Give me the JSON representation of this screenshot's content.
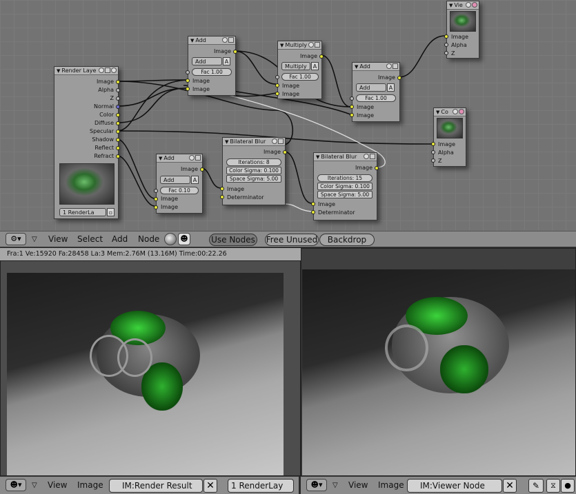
{
  "node_editor": {
    "nodes": {
      "render_layers": {
        "title": "Render Laye",
        "outputs": [
          "Image",
          "Alpha",
          "Z",
          "Normal",
          "Color",
          "Diffuse",
          "Specular",
          "Shadow",
          "Reflect",
          "Refract"
        ],
        "layer_select": "1 RenderLa"
      },
      "add1": {
        "title": "Add",
        "mode": "Add",
        "a_label": "A",
        "fac": "Fac 1.00",
        "out": "Image",
        "in1": "Image",
        "in2": "Image"
      },
      "multiply": {
        "title": "Multiply",
        "mode": "Multiply",
        "a_label": "A",
        "fac": "Fac 1.00",
        "out": "Image",
        "in1": "Image",
        "in2": "Image"
      },
      "add2": {
        "title": "Add",
        "mode": "Add",
        "a_label": "A",
        "fac": "Fac 1.00",
        "out": "Image",
        "in1": "Image",
        "in2": "Image"
      },
      "viewer": {
        "title": "Vie",
        "inputs": [
          "Image",
          "Alpha",
          "Z"
        ]
      },
      "composite": {
        "title": "Co",
        "inputs": [
          "Image",
          "Alpha",
          "Z"
        ]
      },
      "bilateral1": {
        "title": "Bilateral Blur",
        "out": "Image",
        "iterations": "Iterations: 8",
        "color_sigma": "Color Sigma: 0.100",
        "space_sigma": "Space Sigma: 5.00",
        "in1": "Image",
        "in2": "Determinator"
      },
      "add3": {
        "title": "Add",
        "mode": "Add",
        "a_label": "A",
        "fac": "Fac 0.10",
        "out": "Image",
        "in1": "Image",
        "in2": "Image"
      },
      "bilateral2": {
        "title": "Bilateral Blur",
        "out": "Image",
        "iterations": "Iterations: 15",
        "color_sigma": "Color Sigma: 0.100",
        "space_sigma": "Space Sigma: 5.00",
        "in1": "Image",
        "in2": "Determinator"
      }
    }
  },
  "header": {
    "menu": [
      "View",
      "Select",
      "Add",
      "Node"
    ],
    "use_nodes": "Use Nodes",
    "free_unused": "Free Unused",
    "backdrop": "Backdrop"
  },
  "status_line": "Fra:1  Ve:15920 Fa:28458 La:3 Mem:2.76M (13.16M) Time:00:22.26",
  "left_footer": {
    "view": "View",
    "image": "Image",
    "image_name": "IM:Render Result",
    "layer": "1 RenderLay"
  },
  "right_footer": {
    "view": "View",
    "image": "Image",
    "image_name": "IM:Viewer Node"
  },
  "colors": {
    "editor_bg": "#737373",
    "node_bg": "#9c9c9c",
    "socket_image": "#e6e638",
    "socket_value": "#b8b8b8",
    "socket_vector": "#6b6bcc",
    "header_bg": "#8c8c8c"
  },
  "icons": [
    "node-editor-type-icon",
    "image-editor-type-icon",
    "material-ball-icon",
    "render-icon",
    "pin-icon",
    "close-icon",
    "brush-icon",
    "dot-icon"
  ]
}
